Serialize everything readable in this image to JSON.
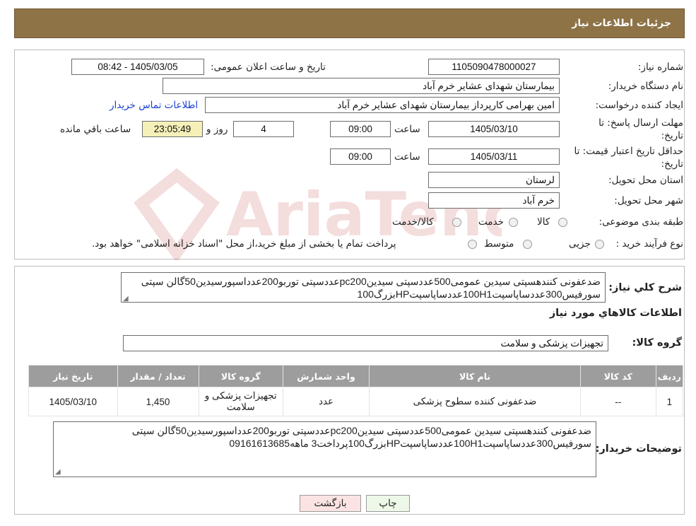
{
  "header": {
    "title": "جزئیات اطلاعات نیاز"
  },
  "form": {
    "need_number_label": "شماره نیاز:",
    "need_number": "1105090478000027",
    "announce_label": "تاریخ و ساعت اعلان عمومی:",
    "announce_value": "1405/03/05 - 08:42",
    "buyer_org_label": "نام دستگاه خریدار:",
    "buyer_org": "بیمارستان شهدای عشایر خرم آباد",
    "creator_label": "ایجاد کننده درخواست:",
    "creator": "امین بهرامی کارپرداز بیمارستان شهدای عشایر خرم آباد",
    "contact_link": "اطلاعات تماس خریدار",
    "deadline_label": "مهلت ارسال پاسخ: تا تاریخ:",
    "deadline_date": "1405/03/10",
    "time_label": "ساعت",
    "deadline_time": "09:00",
    "days_value": "4",
    "days_label": "روز و",
    "remaining_time": "23:05:49",
    "remaining_label": "ساعت باقي مانده",
    "validity_label": "حداقل تاریخ اعتبار قیمت: تا تاریخ:",
    "validity_date": "1405/03/11",
    "validity_time": "09:00",
    "province_label": "استان محل تحویل:",
    "province": "لرستان",
    "city_label": "شهر محل تحویل:",
    "city": "خرم آباد",
    "category_label": "طبقه بندی موضوعی:",
    "category_options": [
      "کالا",
      "خدمت",
      "کالا/خدمت"
    ],
    "process_label": "نوع فرآیند خرید :",
    "process_options": [
      "جزیی",
      "متوسط"
    ],
    "process_note": "پرداخت تمام یا بخشی از مبلغ خرید،از محل \"اسناد خزانه اسلامی\" خواهد بود."
  },
  "summary": {
    "label": "شرح کلي نیاز:",
    "text": "ضدعفونی کنندهسپتی سیدین عمومی500عددسپتی سیدینpc200عددسپتی توربو200عدداسپورسیدین50گالن سپتی سورفیس300عددساپاسپت100H1عددساپاسپتHPبزرگ100"
  },
  "goods": {
    "section_title": "اطلاعات کالاهاي مورد نیاز",
    "group_label": "گروه کالا:",
    "group_value": "تجهیزات پزشکی و سلامت",
    "columns": [
      "رديف",
      "کد کالا",
      "نام کالا",
      "واحد شمارش",
      "گروه کالا",
      "تعداد / مقدار",
      "تاریخ نیاز"
    ],
    "rows": [
      {
        "row": "1",
        "code": "--",
        "name": "ضدعفونی کننده سطوح پزشکی",
        "unit": "عدد",
        "group": "تجهیزات پزشکی و سلامت",
        "qty": "1,450",
        "date": "1405/03/10"
      }
    ]
  },
  "buyer_notes": {
    "label": "توضیحات خریدار:",
    "text": "ضدعفونی کنندهسپتی سیدین عمومی500عددسپتی سیدینpc200عددسپتی توربو200عدداسپورسیدین50گالن سپتی سورفیس300عددساپاسپت100H1عددساپاسپتHPبزرگ100پرداخت3 ماهه09161613685"
  },
  "buttons": {
    "print": "چاپ",
    "back": "بازگشت"
  },
  "colors": {
    "header_bg": "#8e7347",
    "table_header_bg": "#9d9d9d",
    "back_button_bg": "#fbe3e3",
    "print_button_bg": "#eef8e8"
  }
}
